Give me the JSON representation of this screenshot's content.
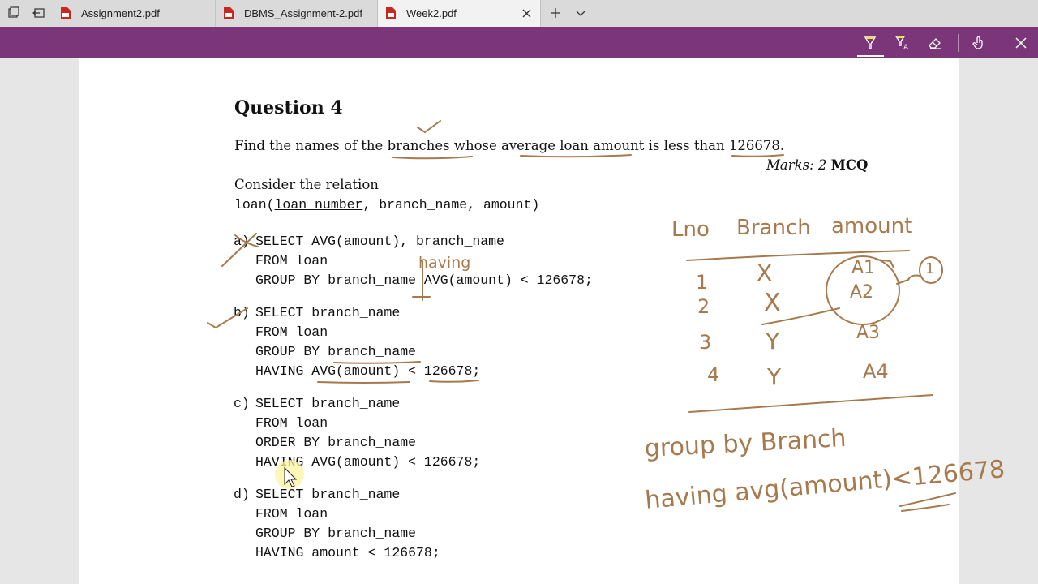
{
  "tabs": [
    {
      "label": "Assignment2.pdf",
      "active": false
    },
    {
      "label": "DBMS_Assignment-2.pdf",
      "active": false
    },
    {
      "label": "Week2.pdf",
      "active": true
    }
  ],
  "toolbar_icons": [
    "highlighter-icon",
    "text-highlight-icon",
    "eraser-icon",
    "touch-writing-icon",
    "close-icon"
  ],
  "colors": {
    "toolbar": "#7b3579",
    "ink": "#a77a4e"
  },
  "doc": {
    "title": "Question 4",
    "prompt": {
      "p1": "Find the names of the ",
      "u1": "branches",
      "p2": " whose average loan amount is less than ",
      "u2": "126678.",
      "p3": ""
    },
    "marks_label": "Marks: 2",
    "marks_type": "MCQ",
    "relation_intro": "Consider the relation",
    "relation": {
      "pre": "loan(",
      "key": "loan_number",
      "post": ", branch_name, amount)"
    },
    "options": [
      {
        "letter": "a)",
        "lines": [
          "SELECT AVG(amount), branch_name",
          "FROM loan",
          "GROUP BY branch_name AVG(amount) < 126678;"
        ]
      },
      {
        "letter": "b)",
        "lines": [
          "SELECT branch_name",
          "FROM loan",
          "GROUP BY branch_name",
          "HAVING AVG(amount) < 126678;"
        ]
      },
      {
        "letter": "c)",
        "lines": [
          "SELECT branch_name",
          "FROM loan",
          "ORDER BY branch_name",
          "HAVING AVG(amount) < 126678;"
        ]
      },
      {
        "letter": "d)",
        "lines": [
          "SELECT branch_name",
          "FROM loan",
          "GROUP BY branch_name",
          "HAVING amount < 126678;"
        ]
      }
    ]
  },
  "handwriting": {
    "having_insert": "having",
    "table_header": [
      "Lno",
      "Branch",
      "amount"
    ],
    "rows": [
      [
        "1",
        "X",
        "A1"
      ],
      [
        "2",
        "X",
        "A2"
      ],
      [
        "3",
        "Y",
        "A3"
      ],
      [
        "4",
        "Y",
        "A4"
      ]
    ],
    "circled": "1",
    "note_line1": "group by Branch",
    "note_line2": "having avg(amount)<126678"
  }
}
